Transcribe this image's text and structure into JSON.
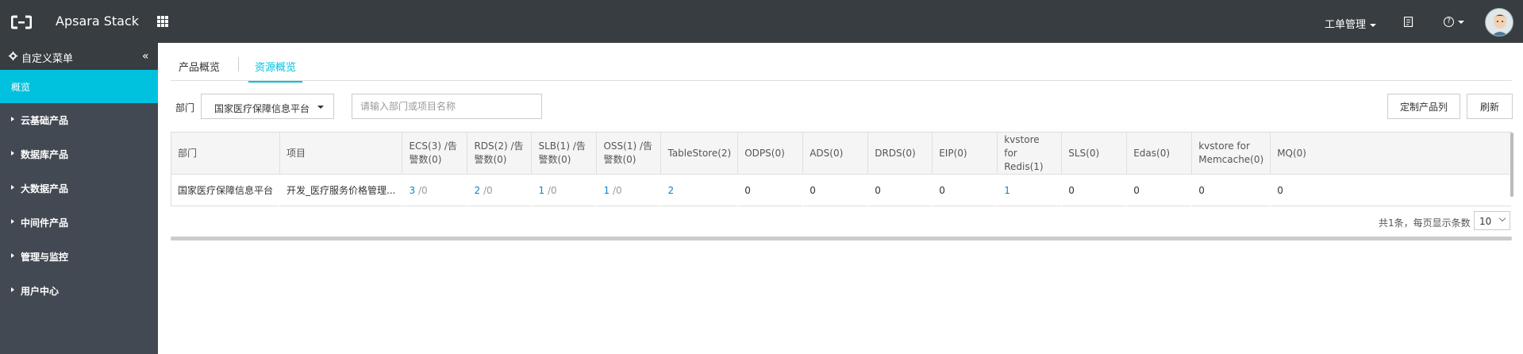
{
  "topbar": {
    "title": "Apsara Stack",
    "ticket_menu": "工单管理",
    "help_symbol": "?"
  },
  "sidebar": {
    "custom_menu": "自定义菜单",
    "collapse_symbol": "«",
    "active_item": "概览",
    "items": [
      {
        "label": "云基础产品"
      },
      {
        "label": "数据库产品"
      },
      {
        "label": "大数据产品"
      },
      {
        "label": "中间件产品"
      },
      {
        "label": "管理与监控"
      },
      {
        "label": "用户中心"
      }
    ]
  },
  "tabs": [
    {
      "label": "产品概览",
      "active": false
    },
    {
      "label": "资源概览",
      "active": true
    }
  ],
  "filter": {
    "dept_label": "部门",
    "dept_value": "国家医疗保障信息平台",
    "search_placeholder": "请输入部门或项目名称"
  },
  "buttons": {
    "custom_products": "定制产品列",
    "refresh": "刷新"
  },
  "table": {
    "columns": [
      "部门",
      "项目",
      "ECS(3) /告警数(0)",
      "RDS(2) /告警数(0)",
      "SLB(1) /告警数(0)",
      "OSS(1) /告警数(0)",
      "TableStore(2)",
      "ODPS(0)",
      "ADS(0)",
      "DRDS(0)",
      "EIP(0)",
      "kvstore for Redis(1)",
      "SLS(0)",
      "Edas(0)",
      "kvstore for Memcache(0)",
      "MQ(0)"
    ],
    "row": {
      "dept": "国家医疗保障信息平台",
      "project": "开发_医疗服务价格管理...",
      "ecs": "3",
      "ecs_alarm": "/0",
      "rds": "2",
      "rds_alarm": "/0",
      "slb": "1",
      "slb_alarm": "/0",
      "oss": "1",
      "oss_alarm": "/0",
      "tablestore": "2",
      "odps": "0",
      "ads": "0",
      "drds": "0",
      "eip": "0",
      "redis": "1",
      "sls": "0",
      "edas": "0",
      "memcache": "0",
      "mq": "0"
    }
  },
  "pager": {
    "summary": "共1条，每页显示条数",
    "page_size": "10"
  },
  "colors": {
    "topbar": "#373d41",
    "sidebar": "#424952",
    "accent": "#00c1de",
    "link": "#0088cc"
  }
}
